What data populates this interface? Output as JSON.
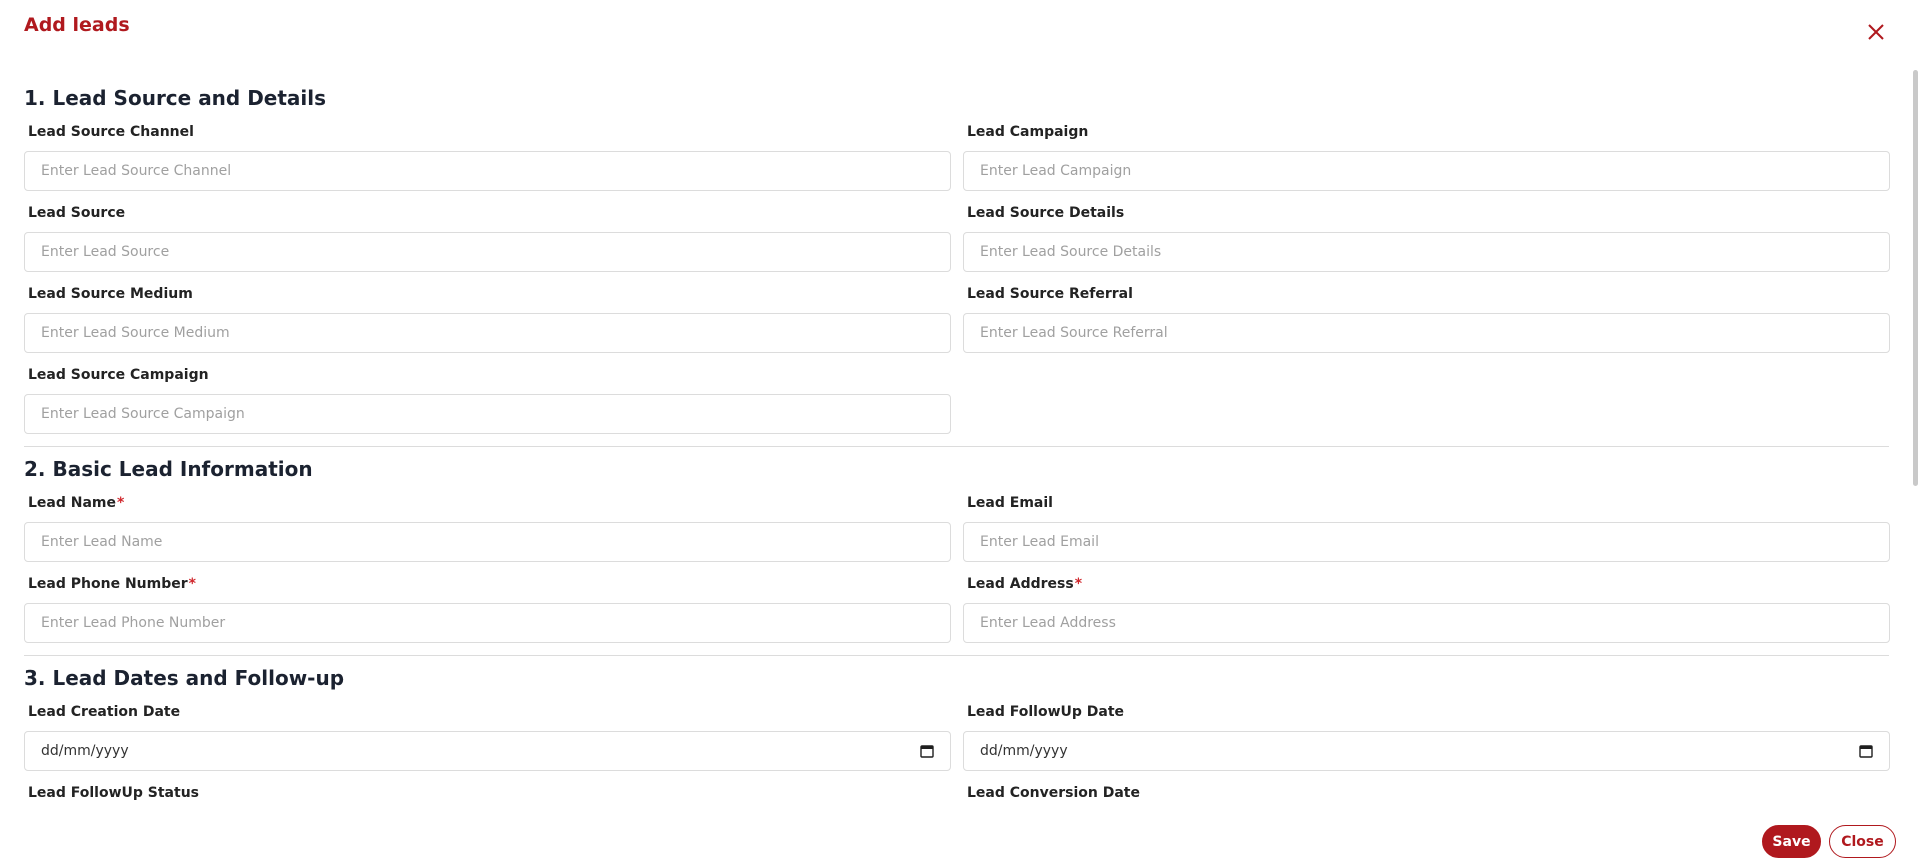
{
  "modal": {
    "title": "Add leads"
  },
  "sections": [
    {
      "title": "1. Lead Source and Details"
    },
    {
      "title": "2. Basic Lead Information"
    },
    {
      "title": "3. Lead Dates and Follow-up"
    }
  ],
  "fields": {
    "lead_source_channel": {
      "label": "Lead Source Channel",
      "placeholder": "Enter Lead Source Channel",
      "value": ""
    },
    "lead_campaign": {
      "label": "Lead Campaign",
      "placeholder": "Enter Lead Campaign",
      "value": ""
    },
    "lead_source": {
      "label": "Lead Source",
      "placeholder": "Enter Lead Source",
      "value": ""
    },
    "lead_source_details": {
      "label": "Lead Source Details",
      "placeholder": "Enter Lead Source Details",
      "value": ""
    },
    "lead_source_medium": {
      "label": "Lead Source Medium",
      "placeholder": "Enter Lead Source Medium",
      "value": ""
    },
    "lead_source_referral": {
      "label": "Lead Source Referral",
      "placeholder": "Enter Lead Source Referral",
      "value": ""
    },
    "lead_source_campaign": {
      "label": "Lead Source Campaign",
      "placeholder": "Enter Lead Source Campaign",
      "value": ""
    },
    "lead_name": {
      "label": "Lead Name",
      "required_mark": "*",
      "placeholder": "Enter Lead Name",
      "value": ""
    },
    "lead_email": {
      "label": "Lead Email",
      "placeholder": "Enter Lead Email",
      "value": ""
    },
    "lead_phone": {
      "label": "Lead Phone Number",
      "required_mark": "*",
      "placeholder": "Enter Lead Phone Number",
      "value": ""
    },
    "lead_address": {
      "label": "Lead Address",
      "required_mark": "*",
      "placeholder": "Enter Lead Address",
      "value": ""
    },
    "lead_creation_date": {
      "label": "Lead Creation Date",
      "value": "dd/mm/yyyy"
    },
    "lead_followup_date": {
      "label": "Lead FollowUp Date",
      "value": "dd/mm/yyyy"
    },
    "lead_followup_status": {
      "label": "Lead FollowUp Status"
    },
    "lead_conversion_date": {
      "label": "Lead Conversion Date"
    }
  },
  "footer": {
    "save_label": "Save",
    "close_label": "Close"
  },
  "icons": {
    "close": "close-icon",
    "calendar": "calendar-icon"
  },
  "colors": {
    "accent": "#b0191e",
    "required": "#d0262c",
    "border": "#dcdcdc",
    "placeholder": "#a0a0a0"
  }
}
